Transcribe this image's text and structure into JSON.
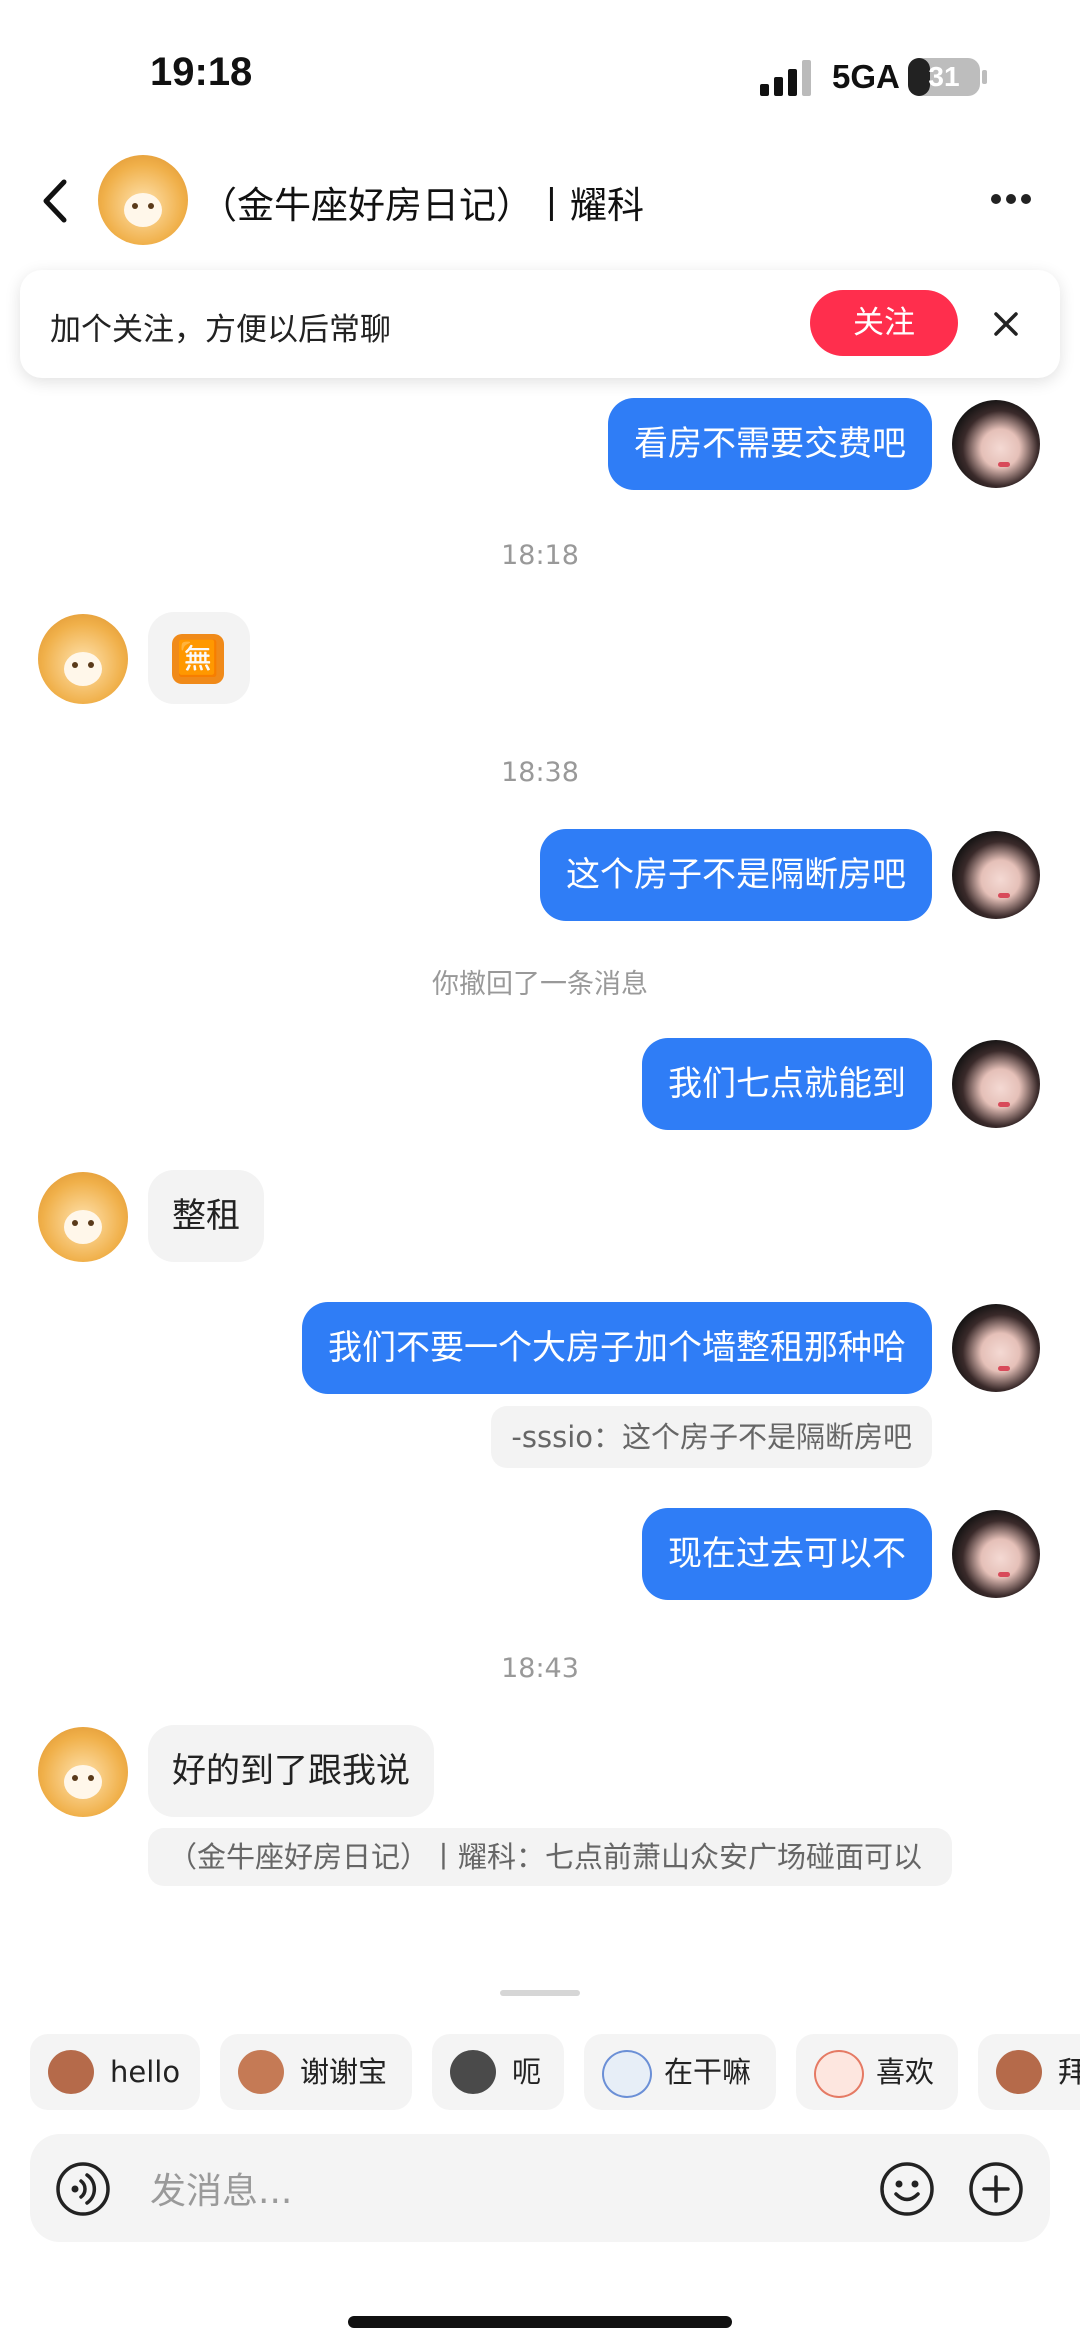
{
  "status_bar": {
    "time": "19:18",
    "network": "5GA",
    "battery": "31",
    "battery_level_pct": 31
  },
  "header": {
    "title": "（金牛座好房日记）丨耀科"
  },
  "follow_banner": {
    "text": "加个关注，方便以后常聊",
    "button": "关注"
  },
  "messages": [
    {
      "side": "me",
      "text": "看房不需要交费吧"
    },
    {
      "type": "time",
      "text": "18:18"
    },
    {
      "side": "other",
      "emoji": "🈚"
    },
    {
      "type": "time",
      "text": "18:38"
    },
    {
      "side": "me",
      "text": "这个房子不是隔断房吧"
    },
    {
      "type": "system",
      "text": "你撤回了一条消息"
    },
    {
      "side": "me",
      "text": "我们七点就能到"
    },
    {
      "side": "other",
      "text": "整租"
    },
    {
      "side": "me",
      "text": "我们不要一个大房子加个墙整租那种哈",
      "quote": "-sssio：这个房子不是隔断房吧"
    },
    {
      "side": "me",
      "text": "现在过去可以不"
    },
    {
      "type": "time",
      "text": "18:43"
    },
    {
      "side": "other",
      "text": "好的到了跟我说",
      "quote": "（金牛座好房日记）丨耀科：七点前萧山众安广场碰面可以"
    }
  ],
  "quick_replies": [
    "hello",
    "谢谢宝",
    "呃",
    "在干嘛",
    "喜欢",
    "拜"
  ],
  "input": {
    "placeholder": "发消息..."
  }
}
